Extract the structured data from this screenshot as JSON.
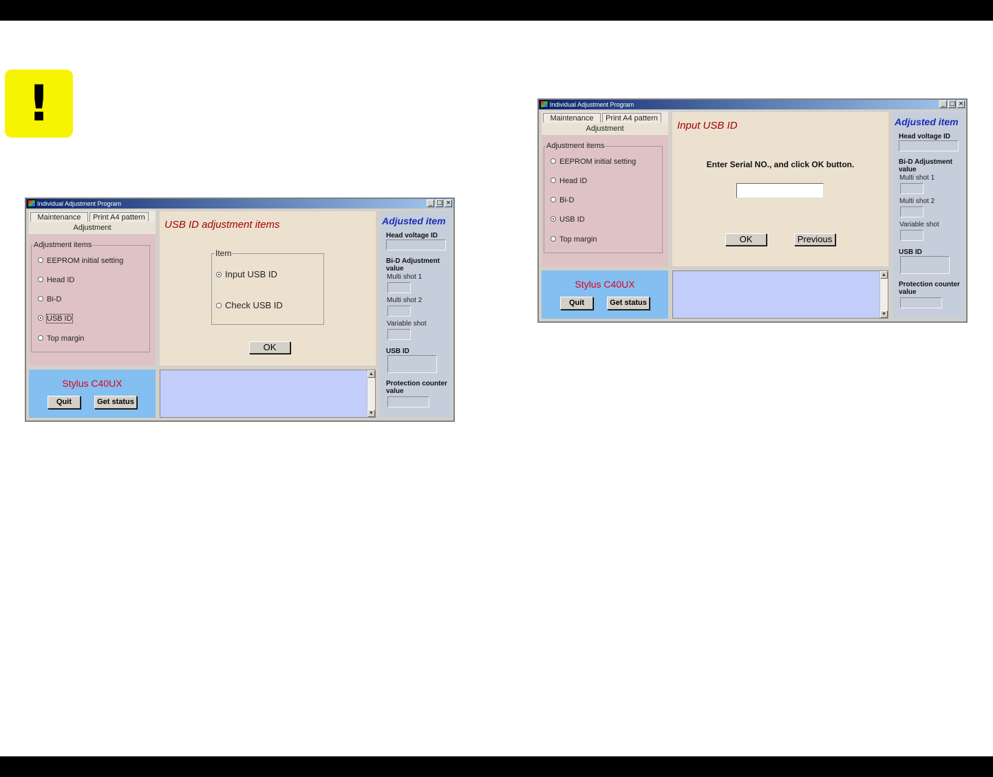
{
  "caution_symbol": "!",
  "window1": {
    "title": "Individual Adjustment Program",
    "tabs": [
      "Maintenance",
      "Print A4 pattern"
    ],
    "active_tab": "Adjustment",
    "group_label": "Adjustment items",
    "items": [
      "EEPROM initial setting",
      "Head ID",
      "Bi-D",
      "USB ID",
      "Top margin"
    ],
    "selected_item": "USB ID",
    "main_title": "USB ID adjustment items",
    "item_group_label": "Item",
    "options": [
      "Input USB ID",
      "Check USB ID"
    ],
    "selected_option": "Input USB ID",
    "ok_label": "OK",
    "model": "Stylus C40UX",
    "quit_label": "Quit",
    "get_status_label": "Get status",
    "adjusted_title": "Adjusted item",
    "head_voltage_label": "Head voltage ID",
    "bid_label": "Bi-D Adjustment value",
    "multi_shot_1": "Multi shot 1",
    "multi_shot_2": "Multi shot 2",
    "variable_shot": "Variable shot",
    "usb_id_label": "USB ID",
    "protection_label": "Protection counter value"
  },
  "window2": {
    "title": "Individual Adjustment Program",
    "tabs": [
      "Maintenance",
      "Print A4 pattern"
    ],
    "active_tab": "Adjustment",
    "group_label": "Adjustment items",
    "items": [
      "EEPROM initial setting",
      "Head ID",
      "Bi-D",
      "USB ID",
      "Top margin"
    ],
    "selected_item": "USB ID",
    "main_title": "Input USB ID",
    "instruction": "Enter Serial NO., and click OK button.",
    "serial_value": "",
    "ok_label": "OK",
    "previous_label": "Previous",
    "model": "Stylus C40UX",
    "quit_label": "Quit",
    "get_status_label": "Get status",
    "adjusted_title": "Adjusted item",
    "head_voltage_label": "Head voltage ID",
    "bid_label": "Bi-D Adjustment value",
    "multi_shot_1": "Multi shot 1",
    "multi_shot_2": "Multi shot 2",
    "variable_shot": "Variable shot",
    "usb_id_label": "USB ID",
    "protection_label": "Protection counter value"
  },
  "colors": {
    "caution": "#f7f400",
    "title_red": "#a30000",
    "model_red": "#e0001c",
    "adjusted_blue": "#1a2db5"
  }
}
